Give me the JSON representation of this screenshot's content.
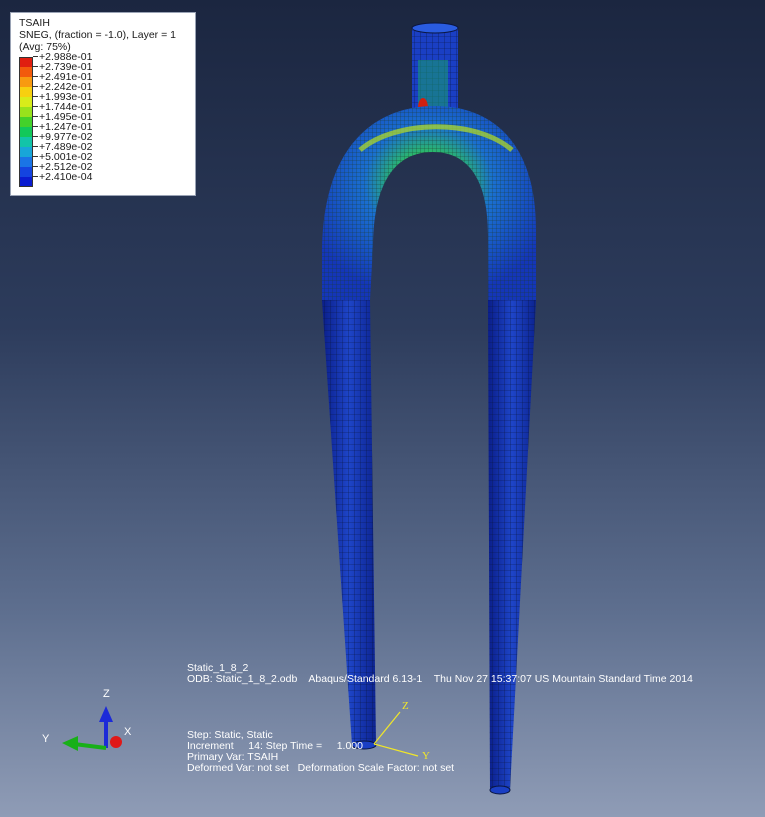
{
  "legend": {
    "variable": "TSAIH",
    "section": "SNEG, (fraction = -1.0), Layer = 1",
    "averaging": "(Avg: 75%)",
    "levels": [
      "+2.988e-01",
      "+2.739e-01",
      "+2.491e-01",
      "+2.242e-01",
      "+1.993e-01",
      "+1.744e-01",
      "+1.495e-01",
      "+1.247e-01",
      "+9.977e-02",
      "+7.489e-02",
      "+5.001e-02",
      "+2.512e-02",
      "+2.410e-04"
    ],
    "colors": [
      "#e01e10",
      "#f25a0c",
      "#f89a10",
      "#f7d010",
      "#d8ec1a",
      "#98e21c",
      "#44d12a",
      "#12c85a",
      "#12c4a8",
      "#18a6d8",
      "#1a74e6",
      "#1444e0",
      "#0a1cd0"
    ]
  },
  "model": {
    "name": "Static_1_8_2",
    "odb": "ODB: Static_1_8_2.odb    Abaqus/Standard 6.13-1    Thu Nov 27 15:37:07 US Mountain Standard Time 2014"
  },
  "step_info": {
    "step": "Step: Static, Static",
    "increment": "Increment     14: Step Time =     1.000",
    "primary_var": "Primary Var: TSAIH",
    "deformed_var": "Deformed Var: not set   Deformation Scale Factor: not set"
  },
  "triad": {
    "z": "Z",
    "y": "Y",
    "x": "X"
  },
  "local_axes": {
    "z": "Z",
    "y": "Y"
  }
}
